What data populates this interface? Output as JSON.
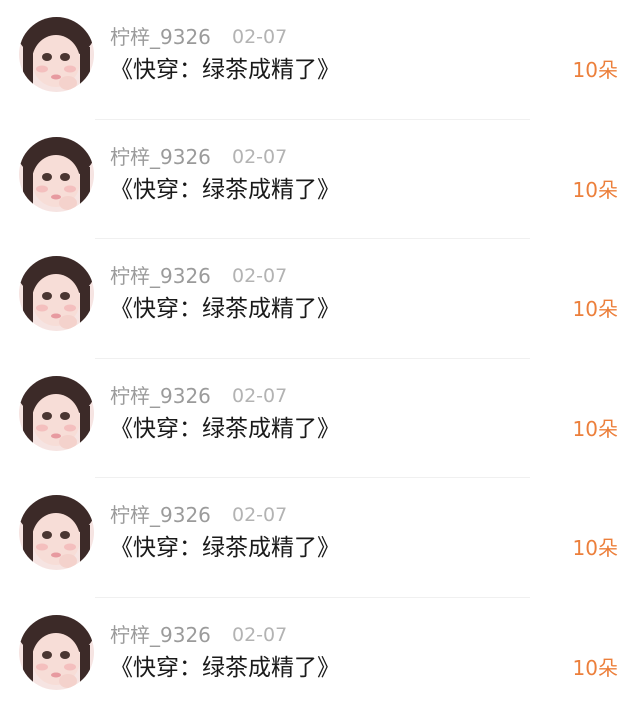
{
  "entries": [
    {
      "username": "柠梓_9326",
      "date": "02-07",
      "title": "《快穿：绿茶成精了》",
      "gift": "10朵"
    },
    {
      "username": "柠梓_9326",
      "date": "02-07",
      "title": "《快穿：绿茶成精了》",
      "gift": "10朵"
    },
    {
      "username": "柠梓_9326",
      "date": "02-07",
      "title": "《快穿：绿茶成精了》",
      "gift": "10朵"
    },
    {
      "username": "柠梓_9326",
      "date": "02-07",
      "title": "《快穿：绿茶成精了》",
      "gift": "10朵"
    },
    {
      "username": "柠梓_9326",
      "date": "02-07",
      "title": "《快穿：绿茶成精了》",
      "gift": "10朵"
    },
    {
      "username": "柠梓_9326",
      "date": "02-07",
      "title": "《快穿：绿茶成精了》",
      "gift": "10朵"
    }
  ],
  "colors": {
    "username": "#9b9b9b",
    "date": "#b3b3b3",
    "title": "#1a1a1a",
    "gift": "#ec7f3b"
  },
  "icons": {
    "avatar": "avatar-icon"
  }
}
